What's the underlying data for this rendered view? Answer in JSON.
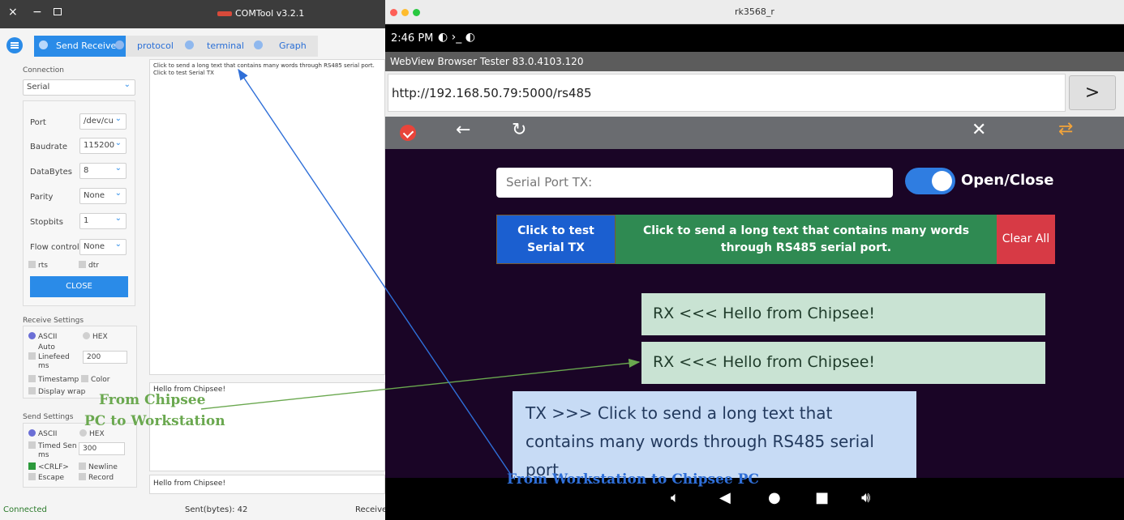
{
  "comtool": {
    "title": "COMTool v3.2.1",
    "tabs": [
      "Send Receive",
      "protocol",
      "terminal",
      "Graph"
    ],
    "connection": {
      "label": "Connection",
      "type": "Serial",
      "port_label": "Port",
      "port_value": "/dev/cu",
      "baud_label": "Baudrate",
      "baud_value": "115200",
      "databytes_label": "DataBytes",
      "databytes_value": "8",
      "parity_label": "Parity",
      "parity_value": "None",
      "stopbits_label": "Stopbits",
      "stopbits_value": "1",
      "flow_label": "Flow control",
      "flow_value": "None",
      "rts": "rts",
      "dtr": "dtr",
      "close_button": "CLOSE"
    },
    "receive_settings": {
      "label": "Receive Settings",
      "ascii": "ASCII",
      "hex": "HEX",
      "auto": "Auto",
      "linefeed": "Linefeed",
      "ms": "ms",
      "linefeed_value": "200",
      "timestamp": "Timestamp",
      "color": "Color",
      "display_wrap": "Display wrap"
    },
    "send_settings": {
      "label": "Send Settings",
      "ascii": "ASCII",
      "hex": "HEX",
      "timed_send": "Timed Sen",
      "ms": "ms",
      "timed_value": "300",
      "crlf": "<CRLF>",
      "newline": "Newline",
      "escape": "Escape",
      "record": "Record"
    },
    "receive_text_line1": "Click to send a long text that contains many words through RS485 serial port.",
    "receive_text_line2": "Click to test Serial TX",
    "send_area_text": "Hello from Chipsee!",
    "send_input_text": "Hello from Chipsee!",
    "status": {
      "connected": "Connected",
      "sent": "Sent(bytes): 42",
      "received": "Receive"
    }
  },
  "rk": {
    "window_title": "rk3568_r",
    "time": "2:46 PM",
    "webview_title": "WebView Browser Tester 83.0.4103.120",
    "url": "http://192.168.50.79:5000/rs485",
    "go_button": ">",
    "serial_placeholder": "Serial Port TX:",
    "toggle_label": "Open/Close",
    "btn_test": "Click to test Serial TX",
    "btn_long": "Click to send a long text that contains many words through RS485 serial port.",
    "btn_clear": "Clear All",
    "rx1": "RX <<< Hello from Chipsee!",
    "rx2": "RX <<< Hello from Chipsee!",
    "tx": "TX >>> Click to send a long text that contains many words through RS485 serial port"
  },
  "annotations": {
    "from_chipsee_line1": "From Chipsee",
    "from_chipsee_line2": "PC to Workstation",
    "from_workstation": "From Workstation to Chipsee PC",
    "green": "#6aa84f",
    "blue": "#2f6fd8"
  }
}
